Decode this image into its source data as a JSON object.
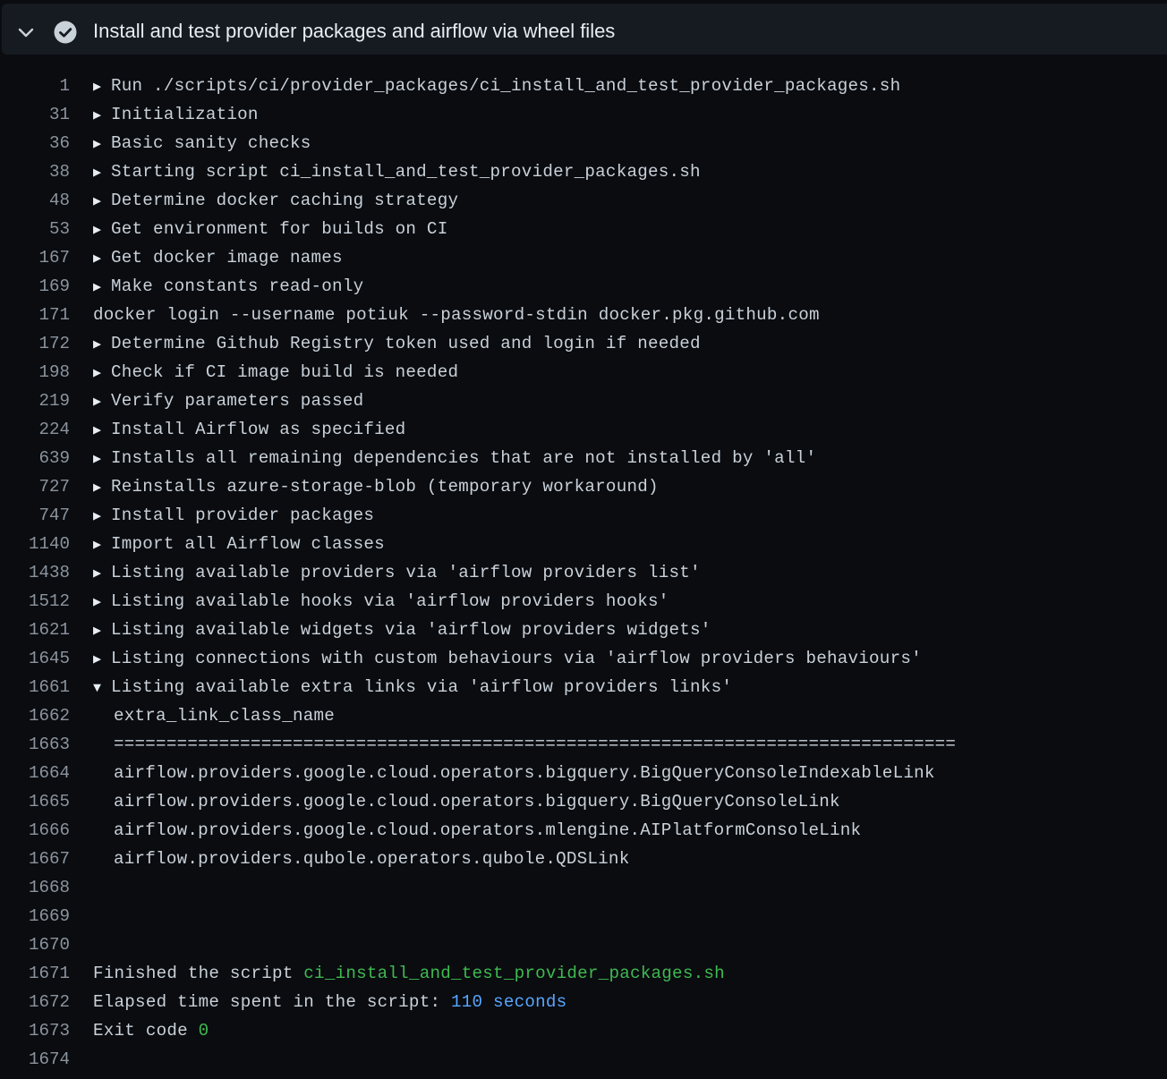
{
  "step": {
    "title": "Install and test provider packages and airflow via wheel files",
    "status": "success"
  },
  "lines": [
    {
      "n": "1",
      "kind": "group",
      "text": "Run ./scripts/ci/provider_packages/ci_install_and_test_provider_packages.sh"
    },
    {
      "n": "31",
      "kind": "group",
      "text": "Initialization"
    },
    {
      "n": "36",
      "kind": "group",
      "text": "Basic sanity checks"
    },
    {
      "n": "38",
      "kind": "group",
      "text": "Starting script ci_install_and_test_provider_packages.sh"
    },
    {
      "n": "48",
      "kind": "group",
      "text": "Determine docker caching strategy"
    },
    {
      "n": "53",
      "kind": "group",
      "text": "Get environment for builds on CI"
    },
    {
      "n": "167",
      "kind": "group",
      "text": "Get docker image names"
    },
    {
      "n": "169",
      "kind": "group",
      "text": "Make constants read-only"
    },
    {
      "n": "171",
      "kind": "plain",
      "text": "docker login --username potiuk --password-stdin docker.pkg.github.com"
    },
    {
      "n": "172",
      "kind": "group",
      "text": "Determine Github Registry token used and login if needed"
    },
    {
      "n": "198",
      "kind": "group",
      "text": "Check if CI image build is needed"
    },
    {
      "n": "219",
      "kind": "group",
      "text": "Verify parameters passed"
    },
    {
      "n": "224",
      "kind": "group",
      "text": "Install Airflow as specified"
    },
    {
      "n": "639",
      "kind": "group",
      "text": "Installs all remaining dependencies that are not installed by 'all'"
    },
    {
      "n": "727",
      "kind": "group",
      "text": "Reinstalls azure-storage-blob (temporary workaround)"
    },
    {
      "n": "747",
      "kind": "group",
      "text": "Install provider packages"
    },
    {
      "n": "1140",
      "kind": "group",
      "text": "Import all Airflow classes"
    },
    {
      "n": "1438",
      "kind": "group",
      "text": "Listing available providers via 'airflow providers list'"
    },
    {
      "n": "1512",
      "kind": "group",
      "text": "Listing available hooks via 'airflow providers hooks'"
    },
    {
      "n": "1621",
      "kind": "group",
      "text": "Listing available widgets via 'airflow providers widgets'"
    },
    {
      "n": "1645",
      "kind": "group",
      "text": "Listing connections with custom behaviours via 'airflow providers behaviours'"
    },
    {
      "n": "1661",
      "kind": "group-open",
      "text": "Listing available extra links via 'airflow providers links'"
    },
    {
      "n": "1662",
      "kind": "indented",
      "text": "extra_link_class_name"
    },
    {
      "n": "1663",
      "kind": "indented",
      "text": "================================================================================"
    },
    {
      "n": "1664",
      "kind": "indented",
      "text": "airflow.providers.google.cloud.operators.bigquery.BigQueryConsoleIndexableLink"
    },
    {
      "n": "1665",
      "kind": "indented",
      "text": "airflow.providers.google.cloud.operators.bigquery.BigQueryConsoleLink"
    },
    {
      "n": "1666",
      "kind": "indented",
      "text": "airflow.providers.google.cloud.operators.mlengine.AIPlatformConsoleLink"
    },
    {
      "n": "1667",
      "kind": "indented",
      "text": "airflow.providers.qubole.operators.qubole.QDSLink"
    },
    {
      "n": "1668",
      "kind": "plain",
      "text": ""
    },
    {
      "n": "1669",
      "kind": "plain",
      "text": ""
    },
    {
      "n": "1670",
      "kind": "plain",
      "text": ""
    },
    {
      "n": "1671",
      "kind": "colored",
      "text": "Finished the script ",
      "hl": "ci_install_and_test_provider_packages.sh",
      "hl_color": "#3fb950"
    },
    {
      "n": "1672",
      "kind": "colored",
      "text": "Elapsed time spent in the script: ",
      "hl": "110 seconds",
      "hl_color": "#58a6ff"
    },
    {
      "n": "1673",
      "kind": "colored",
      "text": "Exit code ",
      "hl": "0",
      "hl_color": "#3fb950"
    },
    {
      "n": "1674",
      "kind": "plain",
      "text": ""
    }
  ],
  "icons": {
    "collapse": "chevron-down-icon",
    "status": "check-circle-icon",
    "group_closed": "triangle-right-icon",
    "group_open": "triangle-down-icon"
  }
}
